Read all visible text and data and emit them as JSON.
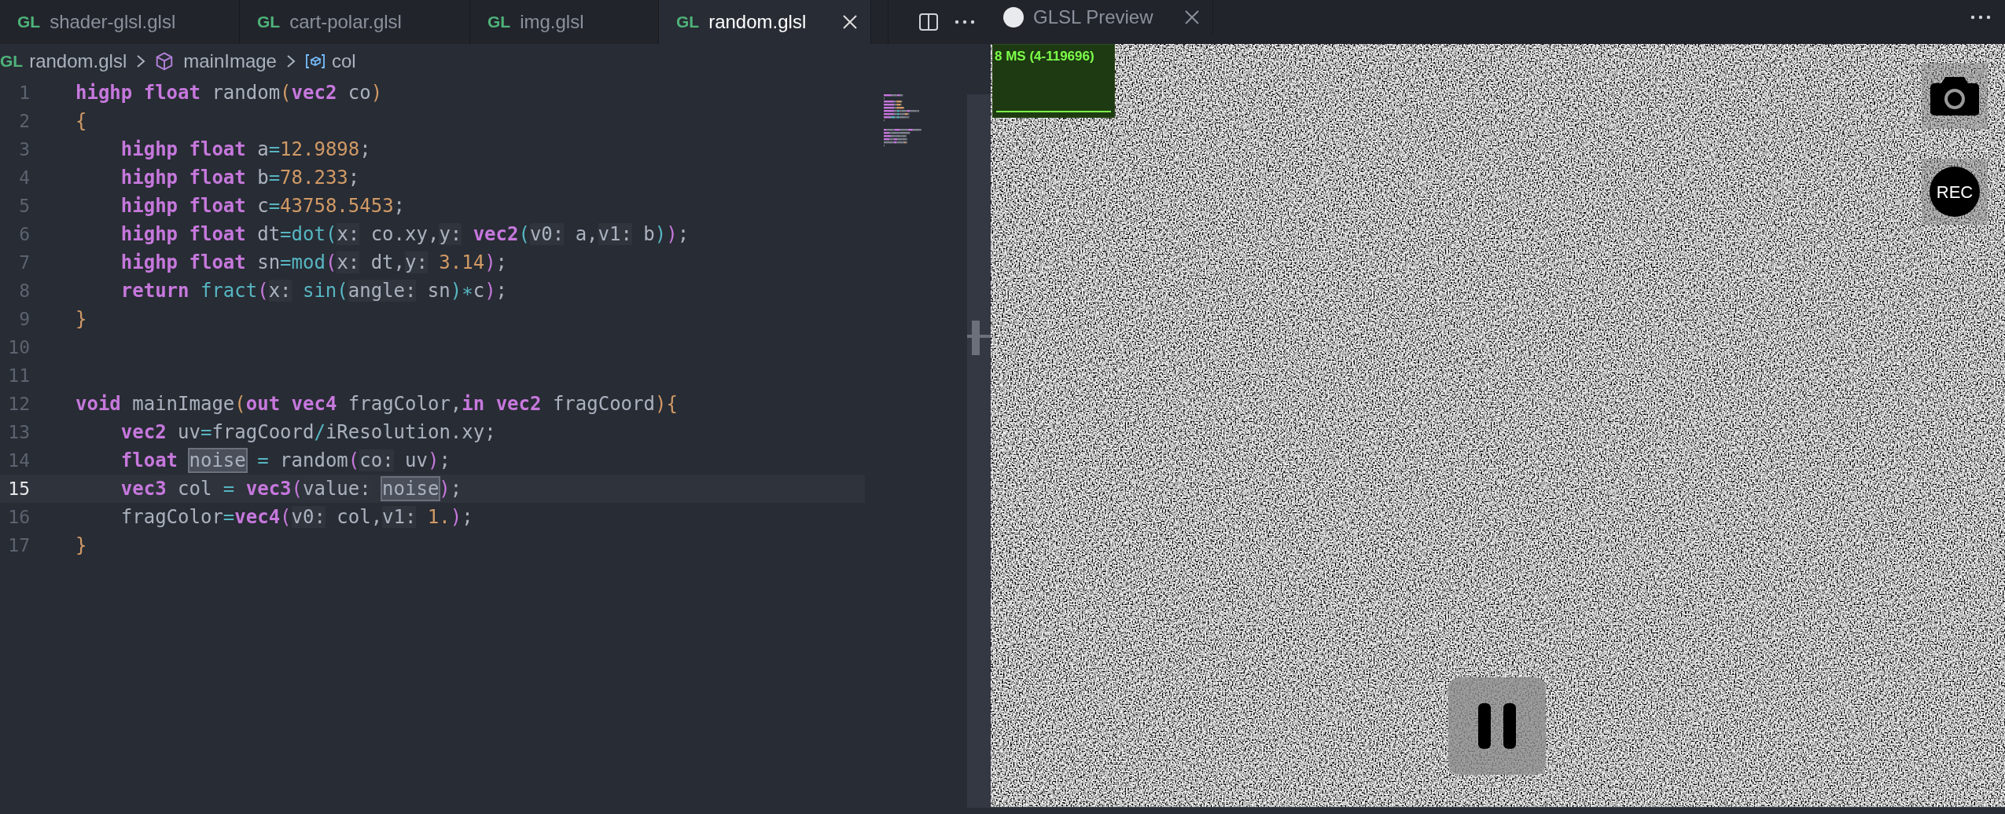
{
  "editor_tabs": [
    {
      "label": "shader-glsl.glsl",
      "icon": "GL",
      "selected": false,
      "closable": false
    },
    {
      "label": "cart-polar.glsl",
      "icon": "GL",
      "selected": false,
      "closable": false
    },
    {
      "label": "img.glsl",
      "icon": "GL",
      "selected": false,
      "closable": false
    },
    {
      "label": "random.glsl",
      "icon": "GL",
      "selected": true,
      "closable": true
    }
  ],
  "breadcrumb": {
    "file_icon": "GL",
    "file": "random.glsl",
    "function": "mainImage",
    "variable": "col"
  },
  "code_lines": [
    {
      "number": "1",
      "current": false,
      "tokens": [
        {
          "t": "highp float",
          "kind": "kw"
        },
        {
          "t": " random",
          "kind": "plain"
        },
        {
          "t": "(",
          "kind": "paren"
        },
        {
          "t": "vec2",
          "kind": "kw"
        },
        {
          "t": " co",
          "kind": "plain"
        },
        {
          "t": ")",
          "kind": "paren"
        }
      ]
    },
    {
      "number": "2",
      "current": false,
      "tokens": [
        {
          "t": "{",
          "kind": "paren"
        }
      ]
    },
    {
      "number": "3",
      "current": false,
      "tokens": [
        {
          "t": "    highp float",
          "kind": "kw"
        },
        {
          "t": " a",
          "kind": "plain"
        },
        {
          "t": "=",
          "kind": "op"
        },
        {
          "t": "12.9898",
          "kind": "num"
        },
        {
          "t": ";",
          "kind": "plain"
        }
      ]
    },
    {
      "number": "4",
      "current": false,
      "tokens": [
        {
          "t": "    highp float",
          "kind": "kw"
        },
        {
          "t": " b",
          "kind": "plain"
        },
        {
          "t": "=",
          "kind": "op"
        },
        {
          "t": "78.233",
          "kind": "num"
        },
        {
          "t": ";",
          "kind": "plain"
        }
      ]
    },
    {
      "number": "5",
      "current": false,
      "tokens": [
        {
          "t": "    highp float",
          "kind": "kw"
        },
        {
          "t": " c",
          "kind": "plain"
        },
        {
          "t": "=",
          "kind": "op"
        },
        {
          "t": "43758.5453",
          "kind": "num"
        },
        {
          "t": ";",
          "kind": "plain"
        }
      ]
    },
    {
      "number": "6",
      "current": false,
      "tokens": [
        {
          "t": "    highp float",
          "kind": "kw"
        },
        {
          "t": " dt",
          "kind": "plain"
        },
        {
          "t": "=",
          "kind": "op"
        },
        {
          "t": "dot",
          "kind": "fn"
        },
        {
          "t": "(",
          "kind": "fnparen"
        },
        {
          "t": "x:",
          "kind": "hint"
        },
        {
          "t": "co.xy,",
          "kind": "plain"
        },
        {
          "t": "y:",
          "kind": "hint"
        },
        {
          "t": "vec2",
          "kind": "kw"
        },
        {
          "t": "(",
          "kind": "fnparen"
        },
        {
          "t": "v0:",
          "kind": "hint"
        },
        {
          "t": "a,",
          "kind": "plain"
        },
        {
          "t": "v1:",
          "kind": "hint"
        },
        {
          "t": "b",
          "kind": "plain"
        },
        {
          "t": ")",
          "kind": "fnparen"
        },
        {
          "t": ")",
          "kind": "kwparen"
        },
        {
          "t": ";",
          "kind": "plain"
        }
      ]
    },
    {
      "number": "7",
      "current": false,
      "tokens": [
        {
          "t": "    highp float",
          "kind": "kw"
        },
        {
          "t": " sn",
          "kind": "plain"
        },
        {
          "t": "=",
          "kind": "op"
        },
        {
          "t": "mod",
          "kind": "fn"
        },
        {
          "t": "(",
          "kind": "kwparen"
        },
        {
          "t": "x:",
          "kind": "hint"
        },
        {
          "t": "dt,",
          "kind": "plain"
        },
        {
          "t": "y:",
          "kind": "hint"
        },
        {
          "t": "3.14",
          "kind": "num"
        },
        {
          "t": ")",
          "kind": "kwparen"
        },
        {
          "t": ";",
          "kind": "plain"
        }
      ]
    },
    {
      "number": "8",
      "current": false,
      "tokens": [
        {
          "t": "    return",
          "kind": "kw"
        },
        {
          "t": " fract",
          "kind": "fn"
        },
        {
          "t": "(",
          "kind": "kwparen"
        },
        {
          "t": "x:",
          "kind": "hint"
        },
        {
          "t": "sin",
          "kind": "fn"
        },
        {
          "t": "(",
          "kind": "fnparen"
        },
        {
          "t": "angle:",
          "kind": "hint"
        },
        {
          "t": "sn",
          "kind": "plain"
        },
        {
          "t": ")",
          "kind": "fnparen"
        },
        {
          "t": "∗",
          "kind": "op"
        },
        {
          "t": "c",
          "kind": "plain"
        },
        {
          "t": ")",
          "kind": "kwparen"
        },
        {
          "t": ";",
          "kind": "plain"
        }
      ]
    },
    {
      "number": "9",
      "current": false,
      "tokens": [
        {
          "t": "}",
          "kind": "paren"
        }
      ]
    },
    {
      "number": "10",
      "current": false
    },
    {
      "number": "11",
      "current": false
    },
    {
      "number": "12",
      "current": false,
      "tokens": [
        {
          "t": "void",
          "kind": "kw"
        },
        {
          "t": " mainImage",
          "kind": "plain"
        },
        {
          "t": "(",
          "kind": "paren"
        },
        {
          "t": "out vec4",
          "kind": "kw"
        },
        {
          "t": " fragColor,",
          "kind": "plain"
        },
        {
          "t": "in vec2",
          "kind": "kw"
        },
        {
          "t": " fragCoord",
          "kind": "plain"
        },
        {
          "t": "){",
          "kind": "paren"
        }
      ]
    },
    {
      "number": "13",
      "current": false,
      "tokens": [
        {
          "t": "    vec2",
          "kind": "kw"
        },
        {
          "t": " uv",
          "kind": "plain"
        },
        {
          "t": "=",
          "kind": "op"
        },
        {
          "t": "fragCoord",
          "kind": "plain"
        },
        {
          "t": "/",
          "kind": "op"
        },
        {
          "t": "iResolution.xy;",
          "kind": "plain"
        }
      ]
    },
    {
      "number": "14",
      "current": false,
      "tokens": [
        {
          "t": "    float ",
          "kind": "kw"
        },
        {
          "t": "noise",
          "kind": "match"
        },
        {
          "t": " =",
          "kind": "op"
        },
        {
          "t": " random",
          "kind": "plain"
        },
        {
          "t": "(",
          "kind": "kwparen"
        },
        {
          "t": "co:",
          "kind": "hint"
        },
        {
          "t": "uv",
          "kind": "plain"
        },
        {
          "t": ")",
          "kind": "kwparen"
        },
        {
          "t": ";",
          "kind": "plain"
        }
      ]
    },
    {
      "number": "15",
      "current": true,
      "tokens": [
        {
          "t": "    vec3",
          "kind": "kw"
        },
        {
          "t": " col",
          "kind": "plain"
        },
        {
          "t": " =",
          "kind": "op"
        },
        {
          "t": " vec3",
          "kind": "kw"
        },
        {
          "t": "(",
          "kind": "kwparen"
        },
        {
          "t": "value:",
          "kind": "hint"
        },
        {
          "t": "noise",
          "kind": "match"
        },
        {
          "t": ")",
          "kind": "kwparen"
        },
        {
          "t": ";",
          "kind": "plain"
        }
      ]
    },
    {
      "number": "16",
      "current": false,
      "tokens": [
        {
          "t": "    fragColor",
          "kind": "plain"
        },
        {
          "t": "=",
          "kind": "op"
        },
        {
          "t": "vec4",
          "kind": "kw"
        },
        {
          "t": "(",
          "kind": "kwparen"
        },
        {
          "t": "v0:",
          "kind": "hint"
        },
        {
          "t": "col,",
          "kind": "plain"
        },
        {
          "t": "v1:",
          "kind": "hint"
        },
        {
          "t": "1.",
          "kind": "num"
        },
        {
          "t": ")",
          "kind": "kwparen"
        },
        {
          "t": ";",
          "kind": "plain"
        }
      ]
    },
    {
      "number": "17",
      "current": false,
      "tokens": [
        {
          "t": "}",
          "kind": "paren"
        }
      ]
    }
  ],
  "preview_tab": {
    "label": "GLSL Preview"
  },
  "preview": {
    "stats": "8 MS (4-119696)",
    "record_label": "REC"
  }
}
